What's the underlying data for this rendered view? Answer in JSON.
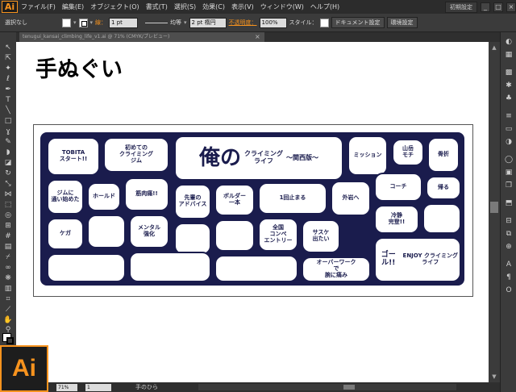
{
  "app": {
    "logo_text": "Ai",
    "menu": [
      "ファイル(F)",
      "編集(E)",
      "オブジェクト(O)",
      "書式(T)",
      "選択(S)",
      "効果(C)",
      "表示(V)",
      "ウィンドウ(W)",
      "ヘルプ(H)"
    ],
    "workspace": "初期設定",
    "window_controls": [
      "_",
      "□",
      "×"
    ],
    "accent_color": "#f7931e"
  },
  "controlbar": {
    "selection": "選択なし",
    "stroke_label": "線：",
    "stroke_weight": "1 pt",
    "profile": "均等",
    "brush": "2 pt 楕円",
    "opacity_label": "不透明度：",
    "opacity_value": "100%",
    "style_label": "スタイル：",
    "doc_settings": "ドキュメント設定",
    "prefs": "環境設定"
  },
  "document": {
    "tab_title": "tenugui_kansai_climbing_life_v1.ai @ 71% (CMYK/プレビュー)",
    "title": "手ぬぐい"
  },
  "mural": {
    "hero": "俺の",
    "hero_sub": "クライミング\nライフ",
    "hero_edition": "〜関西版〜",
    "tobita": "TOBITA\nスタート!!",
    "first_gym": "初めての\nクライミング\nジム",
    "muscle": "筋肉痛!!",
    "bubble_grip": "ジムに\n通い始めた",
    "bubble_teacher": "先輩の\nアドバイス",
    "bubble_1kai": "1回止まる",
    "bubble_rock": "外岩へ",
    "bubble_cold": "冷静\n完登!!",
    "bubble_coach": "コーチ",
    "bubble_mouth": "メンタル\n強化",
    "bubble_kaeru": "帰る",
    "bubble_overwork": "オーバーワーク\nで\n腕に痛み",
    "bubble_senpai": "ケガ",
    "goal": "ゴール!!",
    "enjoy": "ENJOY クライミング\nライフ",
    "boulder": "ボルダー\n一本",
    "yamadake": "山岳\nモチ",
    "broken": "骨折",
    "mitsu": "ミッション",
    "hold": "ホールド",
    "zenkoku": "全国\nコンペ\nエントリー",
    "sasa": "サスケ\n出たい"
  },
  "status": {
    "zoom": "71%",
    "page": "1",
    "tool": "手のひら"
  }
}
